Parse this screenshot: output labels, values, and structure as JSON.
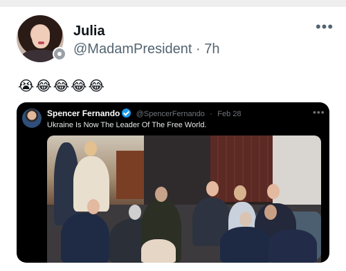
{
  "post": {
    "author_name": "Julia",
    "handle": "@MadamPresident",
    "separator": "·",
    "time": "7h",
    "more_label": "•••",
    "text": "😭😂😂😂😂"
  },
  "quoted_post": {
    "author_name": "Spencer Fernando",
    "handle": "@SpencerFernando",
    "separator": "·",
    "date": "Feb 28",
    "more_label": "•••",
    "text": "Ukraine Is Now The Leader Of The Free World."
  },
  "colors": {
    "verified_blue": "#1d9bf0",
    "secondary_text": "#536471",
    "card_background": "#000000"
  },
  "icons": {
    "avatar_badge": "verified-gray-badge",
    "quote_badge": "verified-check-icon",
    "more": "more-dots-icon"
  }
}
